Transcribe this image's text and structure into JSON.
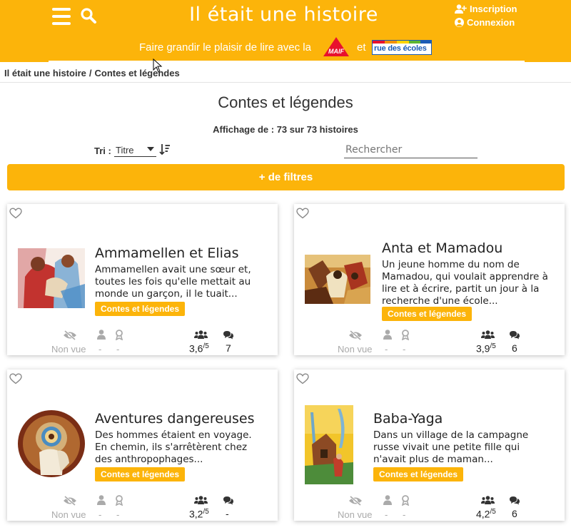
{
  "header": {
    "site_title": "Il était une histoire",
    "register_label": "Inscription",
    "login_label": "Connexion",
    "tagline": "Faire grandir le plaisir de lire avec la",
    "tagline_and": "et",
    "partner1_logo_text": "MAIF",
    "partner2_logo_text": "rue des écoles"
  },
  "breadcrumb": {
    "home": "Il était une histoire",
    "separator": "/",
    "current": "Contes et légendes"
  },
  "page_title": "Contes et légendes",
  "count_text": "Affichage de : 73 sur 73 histoires",
  "sort": {
    "label": "Tri :",
    "selected": "Titre"
  },
  "search": {
    "placeholder": "Rechercher"
  },
  "filters_button": "+ de filtres",
  "colors": {
    "accent": "#fcb40a",
    "muted": "#aaaaaa"
  },
  "stories": [
    {
      "title": "Ammamellen et Elias",
      "description": "Ammamellen avait une sœur et, toutes les fois qu'elle mettait au monde un garçon, il le tuait...",
      "tag": "Contes et légendes",
      "seen_status": "Non vue",
      "stat_user": "-",
      "stat_award": "-",
      "rating": "3,6",
      "rating_max": "/5",
      "comments": "7"
    },
    {
      "title": "Anta et Mamadou",
      "description": "Un jeune homme du nom de Mamadou, qui voulait apprendre à lire et à écrire, partit un jour à la recherche d'une école...",
      "tag": "Contes et légendes",
      "seen_status": "Non vue",
      "stat_user": "-",
      "stat_award": "-",
      "rating": "3,9",
      "rating_max": "/5",
      "comments": "6"
    },
    {
      "title": "Aventures dangereuses",
      "description": "Des hommes étaient en voyage. En chemin, ils s'arrêtèrent chez des anthropophages...",
      "tag": "Contes et légendes",
      "seen_status": "Non vue",
      "stat_user": "-",
      "stat_award": "-",
      "rating": "3,2",
      "rating_max": "/5",
      "comments": "-"
    },
    {
      "title": "Baba-Yaga",
      "description": "Dans un village de la campagne russe vivait une petite fille qui n'avait plus de maman...",
      "tag": "Contes et légendes",
      "seen_status": "Non vue",
      "stat_user": "-",
      "stat_award": "-",
      "rating": "4,2",
      "rating_max": "/5",
      "comments": "6"
    }
  ]
}
